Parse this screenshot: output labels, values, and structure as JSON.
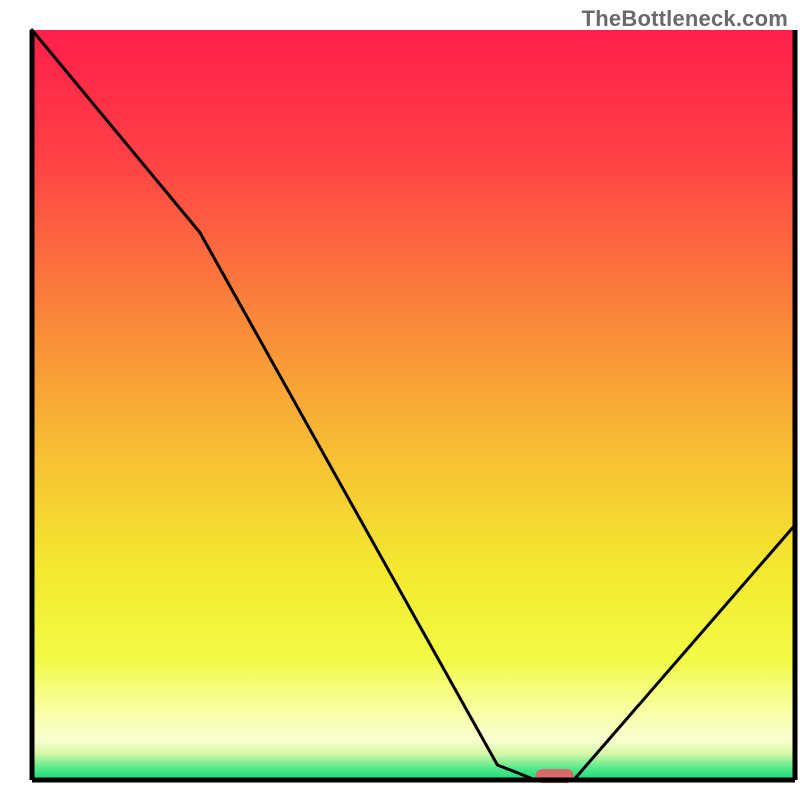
{
  "watermark": "TheBottleneck.com",
  "chart_data": {
    "type": "line",
    "title": "",
    "xlabel": "",
    "ylabel": "",
    "xlim": [
      0,
      100
    ],
    "ylim": [
      0,
      100
    ],
    "grid": false,
    "legend": false,
    "series": [
      {
        "name": "bottleneck-curve",
        "x": [
          0,
          22,
          61,
          66,
          71,
          100
        ],
        "y": [
          100,
          73,
          2,
          0,
          0,
          34
        ]
      }
    ],
    "marker": {
      "name": "optimal-point",
      "x": 68.5,
      "width": 5,
      "color": "#d96a6c"
    },
    "background_gradient": {
      "type": "vertical",
      "stops": [
        {
          "offset": 0.0,
          "color": "#ff1f4b"
        },
        {
          "offset": 0.17,
          "color": "#ff4045"
        },
        {
          "offset": 0.35,
          "color": "#fb7c3c"
        },
        {
          "offset": 0.55,
          "color": "#f8bb34"
        },
        {
          "offset": 0.72,
          "color": "#f4e92f"
        },
        {
          "offset": 0.84,
          "color": "#f1fa45"
        },
        {
          "offset": 0.9,
          "color": "#f7ff99"
        },
        {
          "offset": 0.945,
          "color": "#faffd0"
        },
        {
          "offset": 0.965,
          "color": "#d4f8a8"
        },
        {
          "offset": 0.985,
          "color": "#4fe98a"
        },
        {
          "offset": 1.0,
          "color": "#18da78"
        }
      ]
    },
    "frame_color": "#000000"
  }
}
